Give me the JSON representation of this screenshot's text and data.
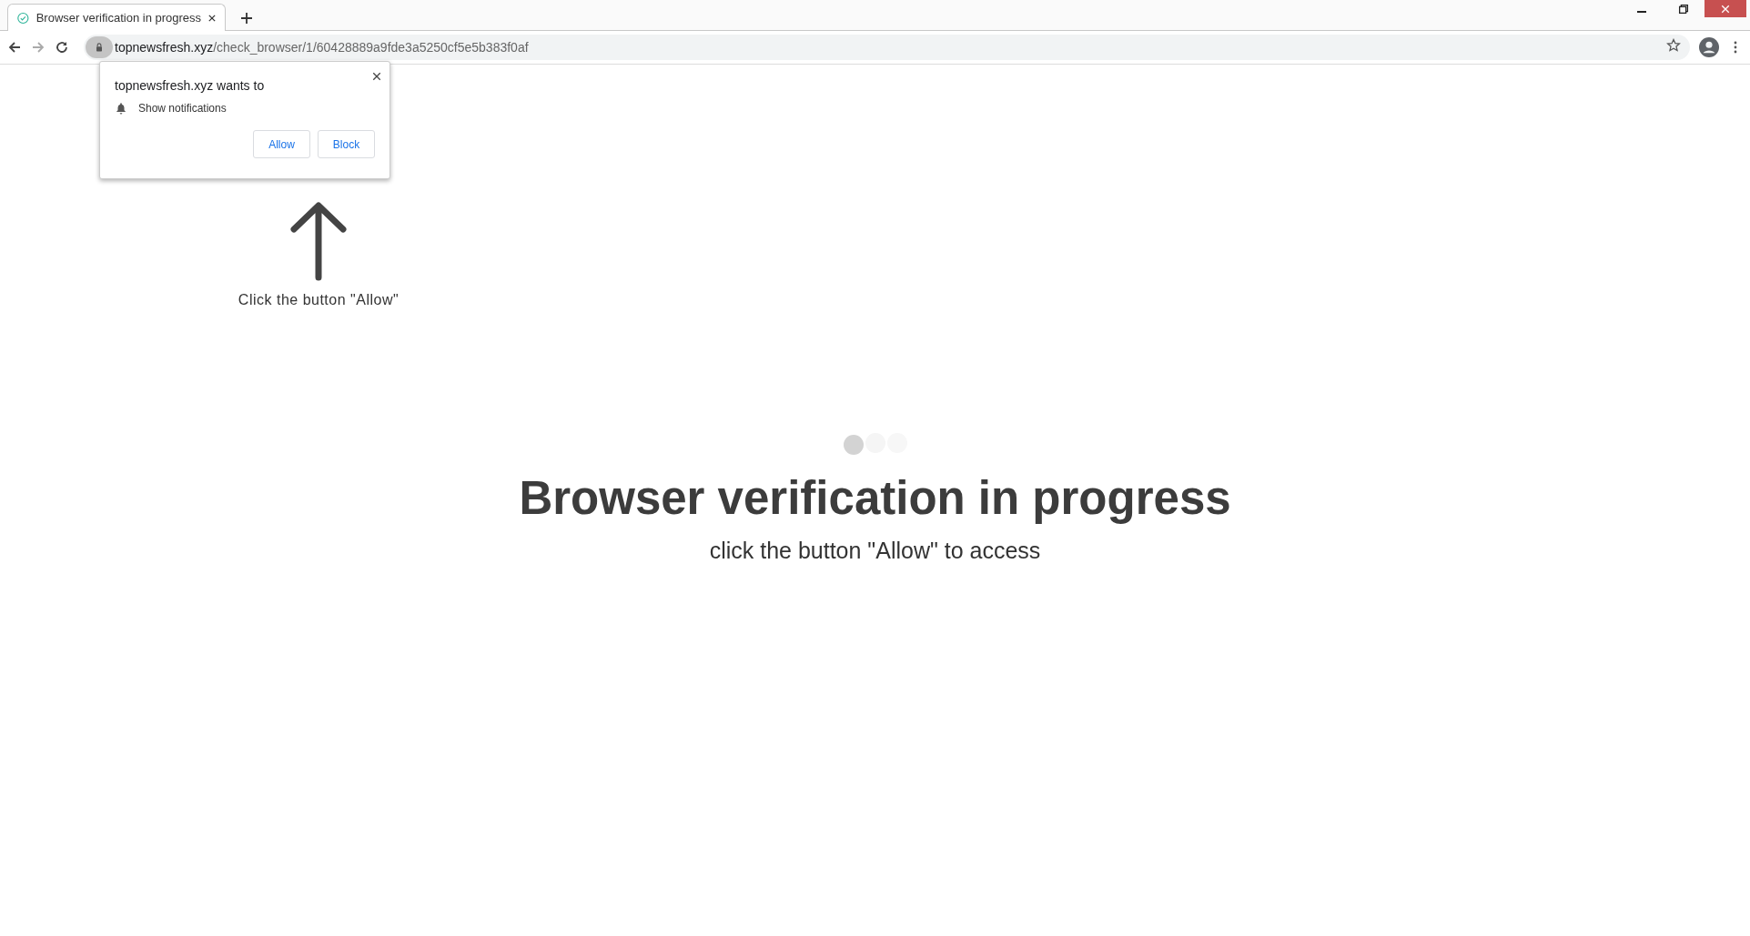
{
  "tab": {
    "title": "Browser verification in progress",
    "selected": true
  },
  "address_bar": {
    "host": "topnewsfresh.xyz",
    "path": "/check_browser/1/60428889a9fde3a5250cf5e5b383f0af"
  },
  "permission_popup": {
    "title": "topnewsfresh.xyz wants to",
    "permission": "Show notifications",
    "buttons": [
      "Allow",
      "Block"
    ]
  },
  "page": {
    "hint": "Click the button \"Allow\"",
    "heading": "Browser verification in progress",
    "subheading": "click the button \"Allow\" to access"
  }
}
